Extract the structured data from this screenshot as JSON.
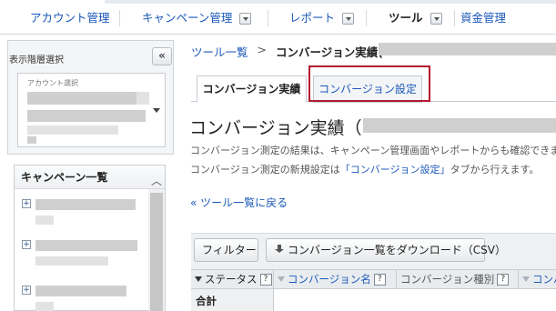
{
  "nav": {
    "items": [
      {
        "label": "アカウント管理",
        "dropdown": false,
        "bold": false
      },
      {
        "label": "キャンペーン管理",
        "dropdown": true,
        "bold": false
      },
      {
        "label": "レポート",
        "dropdown": true,
        "bold": false
      },
      {
        "label": "ツール",
        "dropdown": true,
        "bold": true
      },
      {
        "label": "資金管理",
        "dropdown": false,
        "bold": false
      }
    ]
  },
  "sidebar": {
    "hierarchy_title": "表示階層選択",
    "collapse_label": "«",
    "account_label": "アカウント選択",
    "campaign_title": "キャンペーン一覧",
    "scroll_up_label": "︿",
    "expand_label": "+"
  },
  "breadcrumb": {
    "link": "ツール一覧",
    "separator": ">",
    "current": "コンバージョン実績("
  },
  "tabs": {
    "active": "コンバージョン実績",
    "inactive": "コンバージョン設定"
  },
  "main": {
    "title": "コンバージョン実績（",
    "desc1": "コンバージョン測定の結果は、キャンペーン管理画面やレポートからも確認できま",
    "desc2_pre": "コンバージョン測定の新規設定は",
    "desc2_link": "「コンバージョン設定」",
    "desc2_post": "タブから行えます。",
    "back_link": "« ツール一覧に戻る"
  },
  "toolbar": {
    "filter_label": "フィルター",
    "download_label": "コンバージョン一覧をダウンロード（CSV）"
  },
  "table": {
    "headers": {
      "status": "ステータス",
      "conversion_name": "コンバージョン名",
      "conversion_type": "コンバージョン種別",
      "more": "コンバ"
    },
    "help_glyph": "?",
    "total_label": "合計"
  },
  "colors": {
    "link": "#1b59b9",
    "highlight": "#b5162f"
  }
}
